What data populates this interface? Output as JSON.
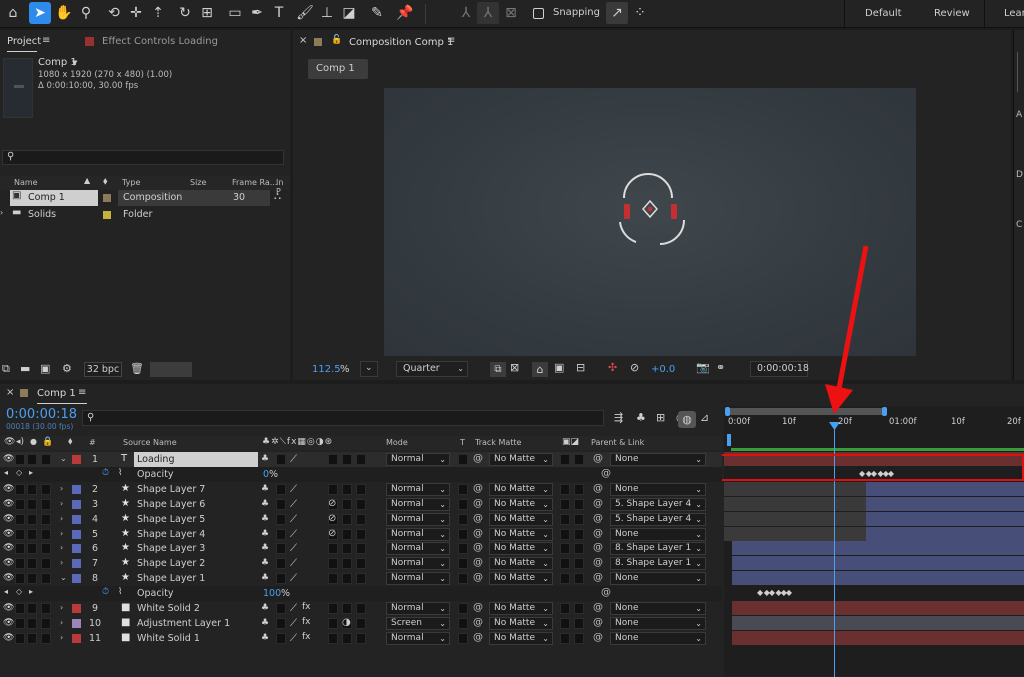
{
  "toolbar": {
    "snapping_label": "Snapping",
    "workspaces": [
      "Default",
      "Review",
      "Learn"
    ]
  },
  "project_panel": {
    "tab_project": "Project",
    "tab_effect_controls": "Effect Controls Loading",
    "comp_name": "Comp 1",
    "comp_size": "1080 x 1920  (270 x 480) (1.00)",
    "comp_duration": "Δ 0:00:10:00, 30.00 fps",
    "columns": {
      "name": "Name",
      "type": "Type",
      "size": "Size",
      "frame_rate": "Frame Ra...",
      "in_point": "In P"
    },
    "items": [
      {
        "name": "Comp 1",
        "type": "Composition",
        "frame_rate": "30",
        "color": "#8c7b5a"
      },
      {
        "name": "Solids",
        "type": "Folder",
        "frame_rate": "",
        "color": "#c9b23a"
      }
    ],
    "bit_depth": "32 bpc"
  },
  "viewer": {
    "tab_title": "Composition Comp 1",
    "comp_button": "Comp 1",
    "zoom": "112.5",
    "zoom_unit": "%",
    "resolution": "Quarter",
    "exposure": "+0.0",
    "current_time": "0:00:00:18"
  },
  "timeline": {
    "tab": "Comp 1",
    "current_time": "0:00:00:18",
    "frame_info": "00018 (30.00 fps)",
    "search_placeholder": "",
    "columns": {
      "num": "#",
      "source_name": "Source Name",
      "mode": "Mode",
      "t": "T",
      "track_matte": "Track Matte",
      "parent_link": "Parent & Link"
    },
    "ruler_labels": [
      "0:00f",
      "10f",
      "20f",
      "01:00f",
      "10f",
      "20f"
    ],
    "layers": [
      {
        "num": "1",
        "name": "Loading",
        "type_icon": "T",
        "mode": "Normal",
        "matte": "No Matte",
        "parent": "None",
        "color": "#b83a3a"
      },
      {
        "prop": "Opacity",
        "value": "0",
        "unit": "%"
      },
      {
        "num": "2",
        "name": "Shape Layer 7",
        "type_icon": "★",
        "mode": "Normal",
        "matte": "No Matte",
        "parent": "None",
        "color": "#5a6ab8"
      },
      {
        "num": "3",
        "name": "Shape Layer 6",
        "type_icon": "★",
        "mode": "Normal",
        "matte": "No Matte",
        "parent": "5. Shape Layer 4",
        "color": "#5a6ab8"
      },
      {
        "num": "4",
        "name": "Shape Layer 5",
        "type_icon": "★",
        "mode": "Normal",
        "matte": "No Matte",
        "parent": "5. Shape Layer 4",
        "color": "#5a6ab8"
      },
      {
        "num": "5",
        "name": "Shape Layer 4",
        "type_icon": "★",
        "mode": "Normal",
        "matte": "No Matte",
        "parent": "None",
        "color": "#5a6ab8"
      },
      {
        "num": "6",
        "name": "Shape Layer 3",
        "type_icon": "★",
        "mode": "Normal",
        "matte": "No Matte",
        "parent": "8. Shape Layer 1",
        "color": "#5a6ab8"
      },
      {
        "num": "7",
        "name": "Shape Layer 2",
        "type_icon": "★",
        "mode": "Normal",
        "matte": "No Matte",
        "parent": "8. Shape Layer 1",
        "color": "#5a6ab8"
      },
      {
        "num": "8",
        "name": "Shape Layer 1",
        "type_icon": "★",
        "mode": "Normal",
        "matte": "No Matte",
        "parent": "None",
        "color": "#5a6ab8"
      },
      {
        "prop": "Opacity",
        "value": "100",
        "unit": "%"
      },
      {
        "num": "9",
        "name": "White Solid 2",
        "type_icon": "■",
        "mode": "Normal",
        "matte": "No Matte",
        "parent": "None",
        "color": "#b83a3a"
      },
      {
        "num": "10",
        "name": "Adjustment Layer 1",
        "type_icon": "■",
        "mode": "Screen",
        "matte": "No Matte",
        "parent": "None",
        "color": "#9a86b8"
      },
      {
        "num": "11",
        "name": "White Solid 1",
        "type_icon": "■",
        "mode": "Normal",
        "matte": "No Matte",
        "parent": "None",
        "color": "#b83a3a"
      }
    ]
  }
}
